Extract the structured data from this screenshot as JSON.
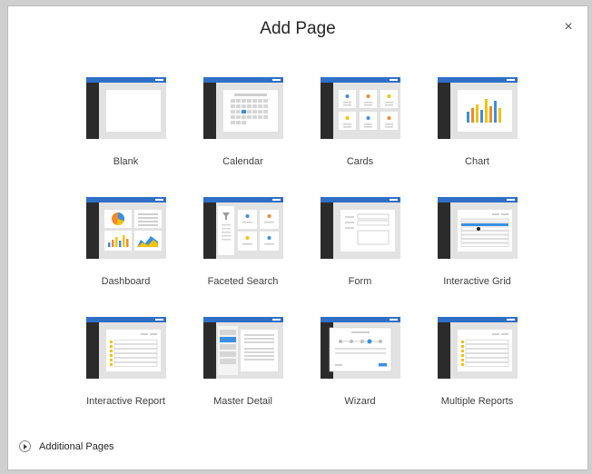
{
  "dialog": {
    "title": "Add Page",
    "close_glyph": "×",
    "additional_pages": "Additional Pages"
  },
  "colors": {
    "header_blue": "#2f6fc6",
    "sidebar_dark": "#2b2b2b",
    "panel_gray": "#e4e4e4",
    "accent_blue": "#3b8fe0",
    "accent_orange": "#f28a2b",
    "accent_yellow": "#f5c20a"
  },
  "page_types": [
    {
      "label": "Blank",
      "icon": "blank-page-icon"
    },
    {
      "label": "Calendar",
      "icon": "calendar-page-icon"
    },
    {
      "label": "Cards",
      "icon": "cards-page-icon"
    },
    {
      "label": "Chart",
      "icon": "chart-page-icon"
    },
    {
      "label": "Dashboard",
      "icon": "dashboard-page-icon"
    },
    {
      "label": "Faceted Search",
      "icon": "faceted-search-page-icon"
    },
    {
      "label": "Form",
      "icon": "form-page-icon"
    },
    {
      "label": "Interactive Grid",
      "icon": "interactive-grid-page-icon"
    },
    {
      "label": "Interactive Report",
      "icon": "interactive-report-page-icon"
    },
    {
      "label": "Master Detail",
      "icon": "master-detail-page-icon"
    },
    {
      "label": "Wizard",
      "icon": "wizard-page-icon"
    },
    {
      "label": "Multiple Reports",
      "icon": "multiple-reports-page-icon"
    }
  ]
}
